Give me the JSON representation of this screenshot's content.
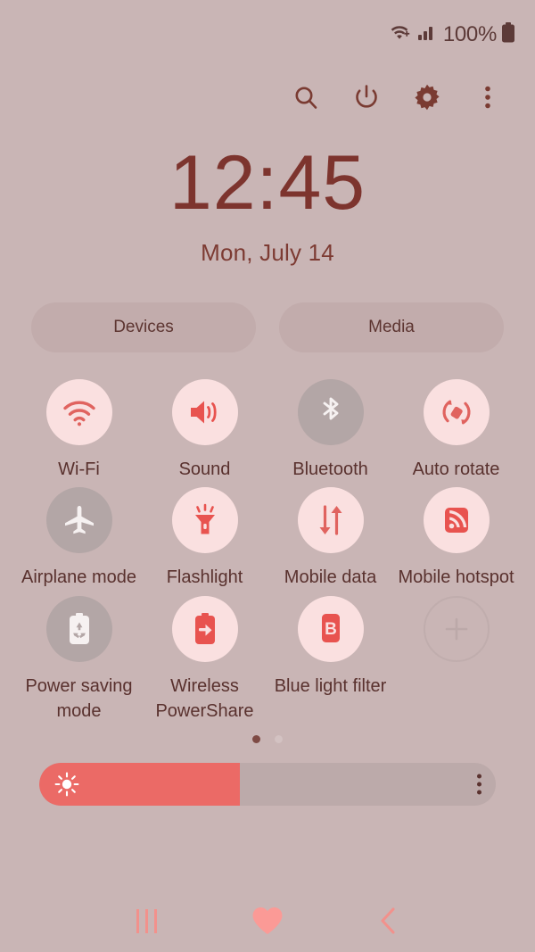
{
  "status_bar": {
    "wifi_icon": "wifi-plus-icon",
    "signal_icon": "cellular-signal-icon",
    "battery_percent": "100%",
    "battery_icon": "battery-full-icon"
  },
  "toolbar": {
    "items": [
      {
        "name": "search-icon",
        "label": "Search"
      },
      {
        "name": "power-icon",
        "label": "Power"
      },
      {
        "name": "settings-gear-icon",
        "label": "Settings"
      },
      {
        "name": "overflow-menu-icon",
        "label": "More options"
      }
    ]
  },
  "clock": {
    "time": "12:45",
    "date": "Mon, July 14"
  },
  "shortcuts": {
    "devices_label": "Devices",
    "media_label": "Media"
  },
  "tiles": [
    [
      {
        "label": "Wi-Fi",
        "icon": "wifi-icon",
        "state": "on"
      },
      {
        "label": "Sound",
        "icon": "sound-icon",
        "state": "on"
      },
      {
        "label": "Bluetooth",
        "icon": "bluetooth-icon",
        "state": "off"
      },
      {
        "label": "Auto rotate",
        "icon": "auto-rotate-icon",
        "state": "on"
      }
    ],
    [
      {
        "label": "Airplane mode",
        "icon": "airplane-icon",
        "state": "off"
      },
      {
        "label": "Flashlight",
        "icon": "flashlight-icon",
        "state": "on"
      },
      {
        "label": "Mobile data",
        "icon": "mobile-data-icon",
        "state": "on"
      },
      {
        "label": "Mobile hotspot",
        "icon": "mobile-hotspot-icon",
        "state": "on"
      }
    ],
    [
      {
        "label": "Power saving mode",
        "icon": "power-saving-icon",
        "state": "off"
      },
      {
        "label": "Wireless PowerShare",
        "icon": "wireless-powershare-icon",
        "state": "on"
      },
      {
        "label": "Blue light filter",
        "icon": "blue-light-filter-icon",
        "state": "on"
      },
      {
        "label": "",
        "icon": "add-tile-icon",
        "state": "add"
      }
    ]
  ],
  "pager": {
    "total": 2,
    "active_index": 0
  },
  "brightness": {
    "icon": "brightness-sun-icon",
    "fill_percent": 44,
    "menu_icon": "brightness-options-icon"
  },
  "navbar": {
    "recents": "recents-icon",
    "home": "home-heart-icon",
    "back": "back-chevron-icon"
  },
  "colors": {
    "background": "#c9b5b5",
    "tile_on_bg": "#fae0e0",
    "tile_off_bg": "#b3a6a6",
    "accent_red": "#e8534f",
    "text_dark": "#59312e",
    "clock_text": "#7d342e",
    "slider_fill": "#eb6a66",
    "slider_track": "#bcaaaa",
    "nav_pink": "#f2918c"
  }
}
